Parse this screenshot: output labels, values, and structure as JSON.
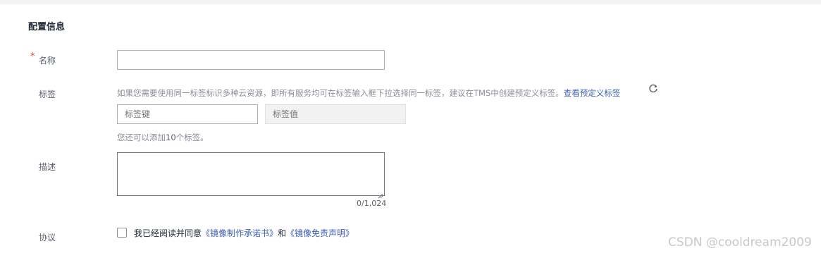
{
  "section": {
    "title": "配置信息"
  },
  "name": {
    "required_mark": "*",
    "label": "名称",
    "value": "",
    "placeholder": ""
  },
  "tags": {
    "label": "标签",
    "hint_prefix": "如果您需要使用同一标签标识多种云资源，即所有服务均可在标签输入框下拉选择同一标签，建议在TMS中创建预定义标签。",
    "hint_link": "查看预定义标签",
    "key_placeholder": "标签键",
    "value_placeholder": "标签值",
    "remaining_prefix": "您还可以添加",
    "remaining_count": "10",
    "remaining_suffix": "个标签。"
  },
  "description": {
    "label": "描述",
    "value": "",
    "counter": "0/1,024"
  },
  "agreement": {
    "label": "协议",
    "text_prefix": "我已经阅读并同意",
    "link1": "《镜像制作承诺书》",
    "conj": "和",
    "link2": "《镜像免责声明》",
    "checked": false
  },
  "watermark": "CSDN @cooldream2009",
  "icons": {
    "refresh": "refresh-icon",
    "resize": "resize-grip-icon"
  }
}
